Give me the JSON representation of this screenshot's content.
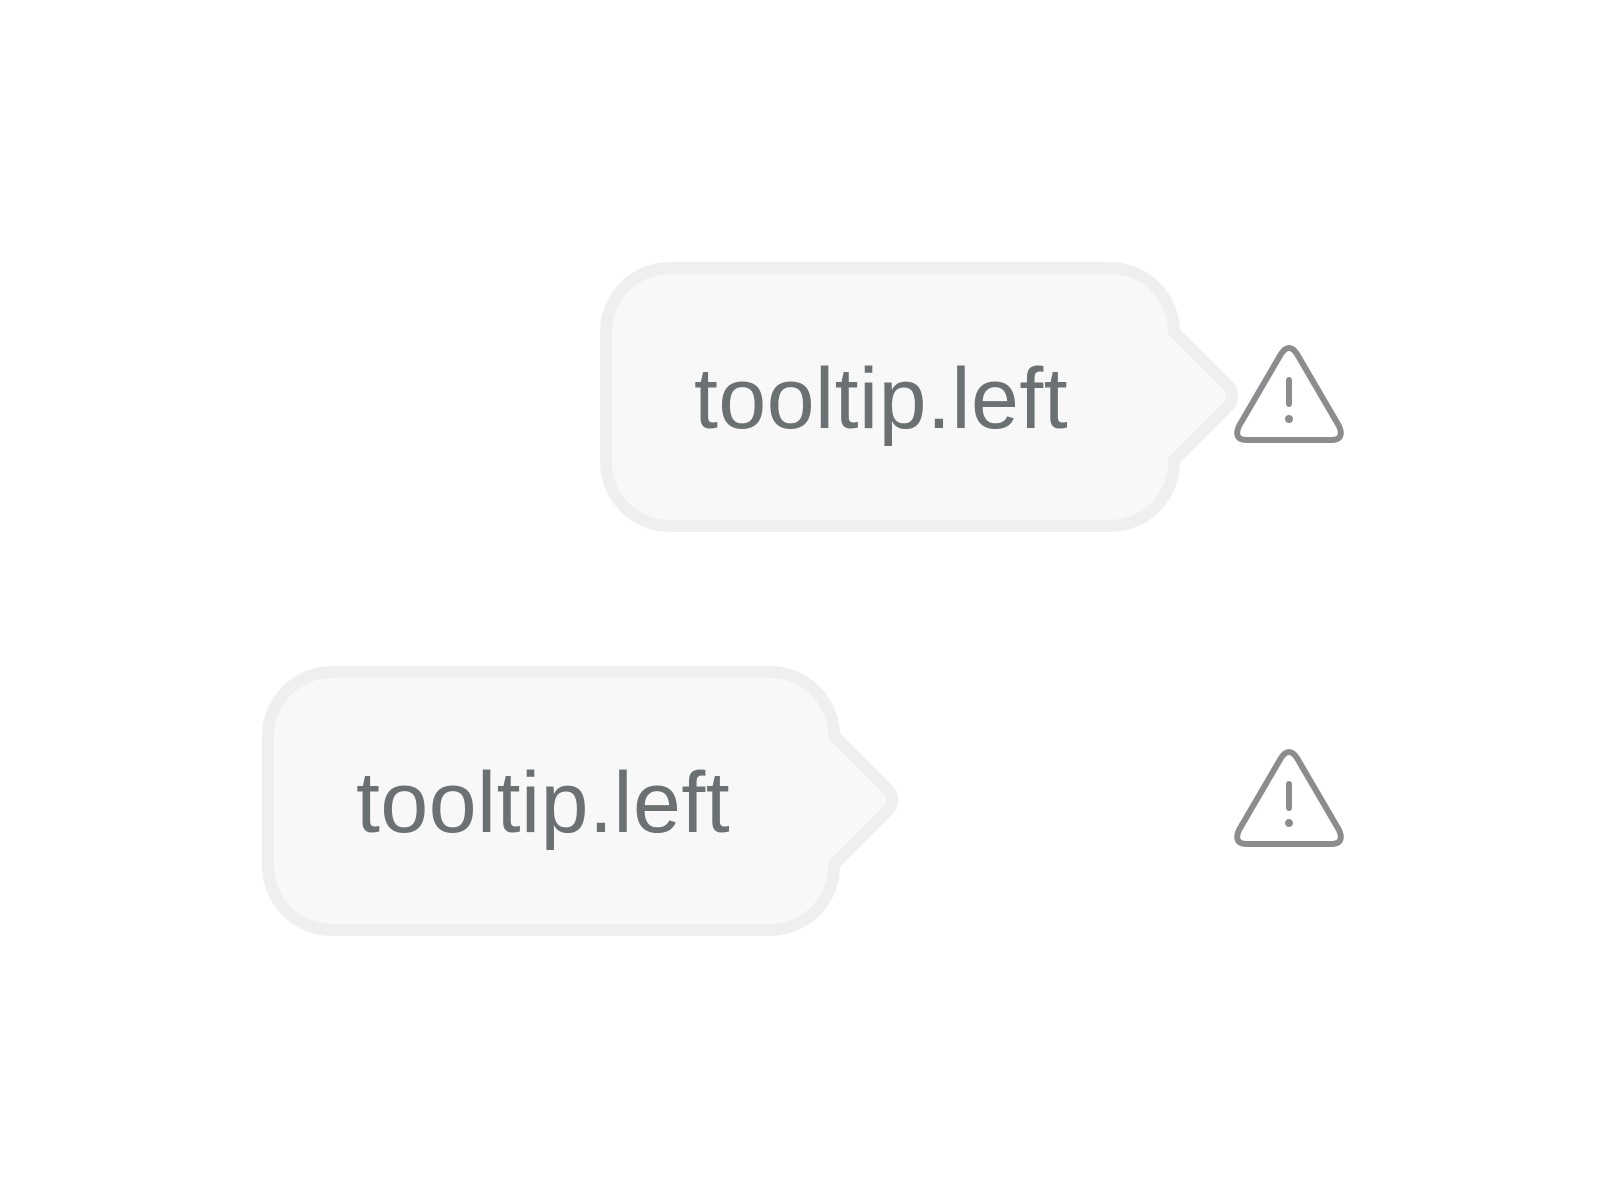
{
  "tooltips": [
    {
      "label": "tooltip.left",
      "icon": "warning-triangle-icon",
      "visible": true
    },
    {
      "label": "tooltip.left",
      "icon": "warning-triangle-icon",
      "visible": true
    }
  ],
  "colors": {
    "tooltip_fill": "#f8f8f8",
    "tooltip_border": "#efefef",
    "text": "#6b7073",
    "icon_stroke": "#8a8c8d"
  }
}
